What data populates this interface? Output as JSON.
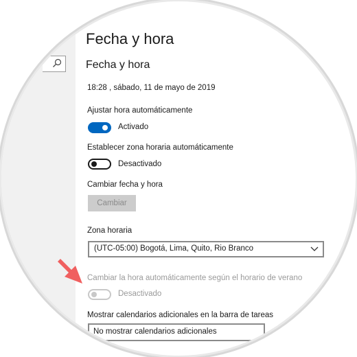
{
  "page": {
    "title": "Fecha y hora",
    "section_title": "Fecha y hora",
    "current_datetime": "18:28 , sábado, 11 de mayo de 2019"
  },
  "settings": {
    "auto_time": {
      "label": "Ajustar hora automáticamente",
      "state_label": "Activado",
      "on": true
    },
    "auto_timezone": {
      "label": "Establecer zona horaria automáticamente",
      "state_label": "Desactivado",
      "on": false
    },
    "change_datetime": {
      "label": "Cambiar fecha y hora",
      "button_label": "Cambiar"
    },
    "timezone": {
      "label": "Zona horaria",
      "value": "(UTC-05:00) Bogotá, Lima, Quito, Rio Branco"
    },
    "dst": {
      "label": "Cambiar la hora automáticamente según el horario de verano",
      "state_label": "Desactivado",
      "on": false,
      "disabled": true
    },
    "extra_calendars": {
      "label": "Mostrar calendarios adicionales en la barra de tareas",
      "value": "No mostrar calendarios adicionales"
    }
  },
  "colors": {
    "accent": "#0067c0",
    "arrow": "#f06060",
    "disabled": "#9a9a9a"
  },
  "icons": {
    "search": "search-icon",
    "dropdown": "chevron-down-icon",
    "annotation": "arrow-pointer-icon"
  }
}
